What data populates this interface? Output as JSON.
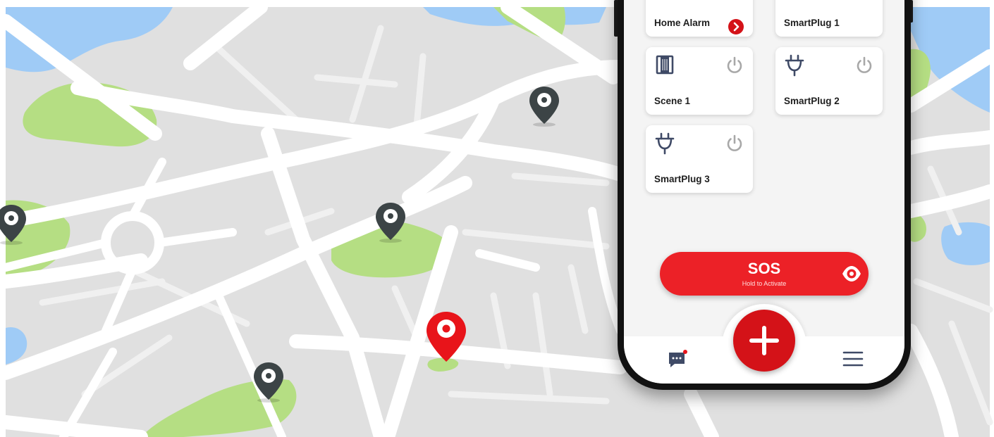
{
  "map": {
    "background_color": "#e0e0e0",
    "road_color": "#ffffff",
    "park_color": "#b5de83",
    "water_color": "#9fcbf6",
    "pin_color": "#3c4446",
    "active_pin_color": "#e8141a"
  },
  "devices": [
    {
      "label": "Home Alarm",
      "icon": "chevron-right-circle-icon"
    },
    {
      "label": "SmartPlug 1",
      "icon": "plug-icon"
    },
    {
      "label": "Scene 1",
      "icon": "scene-icon"
    },
    {
      "label": "SmartPlug 2",
      "icon": "plug-icon"
    },
    {
      "label": "SmartPlug 3",
      "icon": "plug-icon"
    }
  ],
  "sos": {
    "title": "SOS",
    "subtitle": "Hold to Activate",
    "icon": "eye-icon",
    "color": "#ec2127"
  },
  "nav": {
    "chat_icon": "chat-icon",
    "center_icon": "plus-icon",
    "menu_icon": "menu-icon",
    "center_color": "#d41218",
    "notification_dot_color": "#e8141a"
  }
}
